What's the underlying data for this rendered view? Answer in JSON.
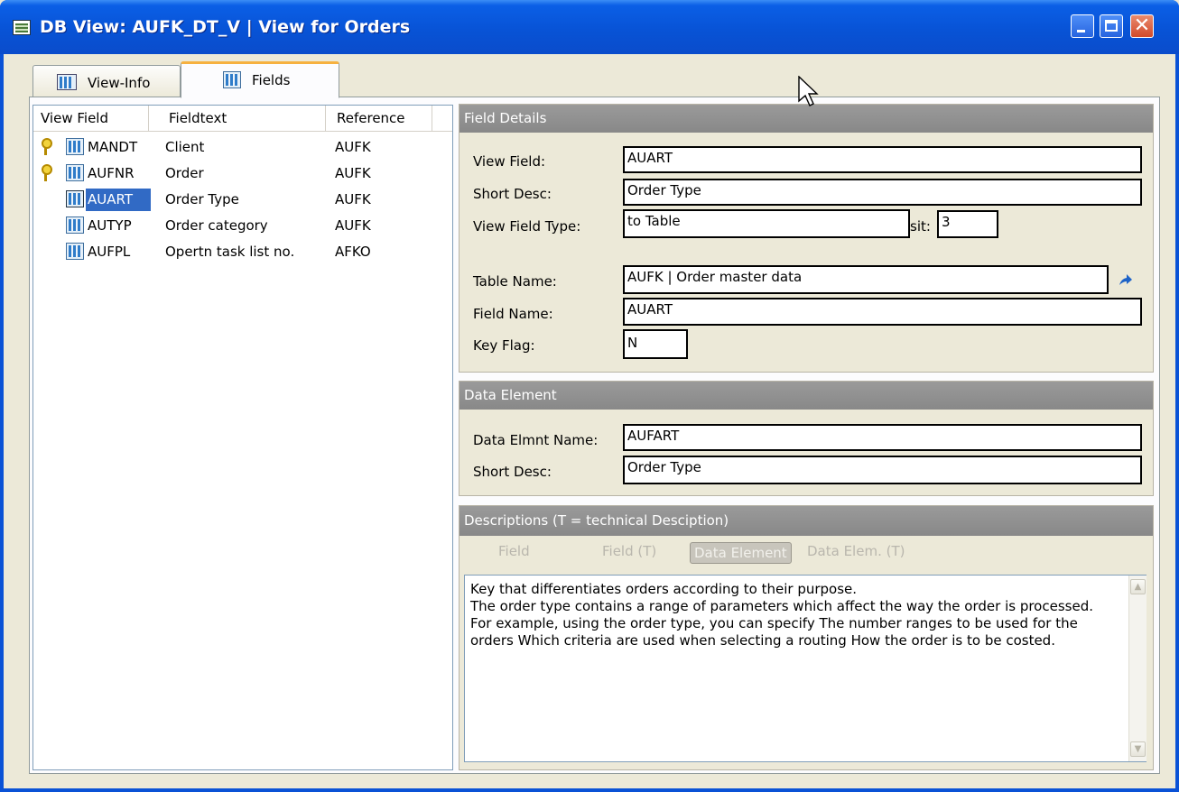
{
  "window": {
    "title": "DB View: AUFK_DT_V | View for Orders"
  },
  "tabs": [
    {
      "label": "View-Info"
    },
    {
      "label": "Fields"
    }
  ],
  "grid": {
    "headers": [
      "View Field",
      "Fieldtext",
      "Reference"
    ],
    "rows": [
      {
        "field": "MANDT",
        "text": "Client",
        "ref": "AUFK",
        "key": true
      },
      {
        "field": "AUFNR",
        "text": "Order",
        "ref": "AUFK",
        "key": true
      },
      {
        "field": "AUART",
        "text": "Order Type",
        "ref": "AUFK",
        "key": false,
        "selected": true
      },
      {
        "field": "AUTYP",
        "text": "Order category",
        "ref": "AUFK",
        "key": false
      },
      {
        "field": "AUFPL",
        "text": "Opertn task list no.",
        "ref": "AFKO",
        "key": false
      }
    ]
  },
  "field_details": {
    "header": "Field Details",
    "view_field_label": "View Field:",
    "view_field": "AUART",
    "short_desc_label": "Short Desc:",
    "short_desc": "Order Type",
    "view_field_type_label": "View Field Type:",
    "view_field_type": "to Table",
    "sit_label": "sit:",
    "sit_value": "3",
    "table_name_label": "Table Name:",
    "table_name": "AUFK | Order master data",
    "field_name_label": "Field Name:",
    "field_name": "AUART",
    "key_flag_label": "Key Flag:",
    "key_flag": "N"
  },
  "data_element": {
    "header": "Data Element",
    "name_label": "Data Elmnt Name:",
    "name": "AUFART",
    "short_desc_label": "Short Desc:",
    "short_desc": "Order Type"
  },
  "descriptions": {
    "header": "Descriptions   (T = technical Desciption)",
    "tabs": [
      "Field",
      "Field (T)",
      "Data Element",
      "Data Elem. (T)"
    ],
    "text": "Key that differentiates orders according to their purpose.\nThe order type contains a range of parameters which affect the way the order is processed. For example, using the order type, you can specify The number ranges to be used for the orders Which criteria are used when selecting a routing How the order is to be costed."
  }
}
